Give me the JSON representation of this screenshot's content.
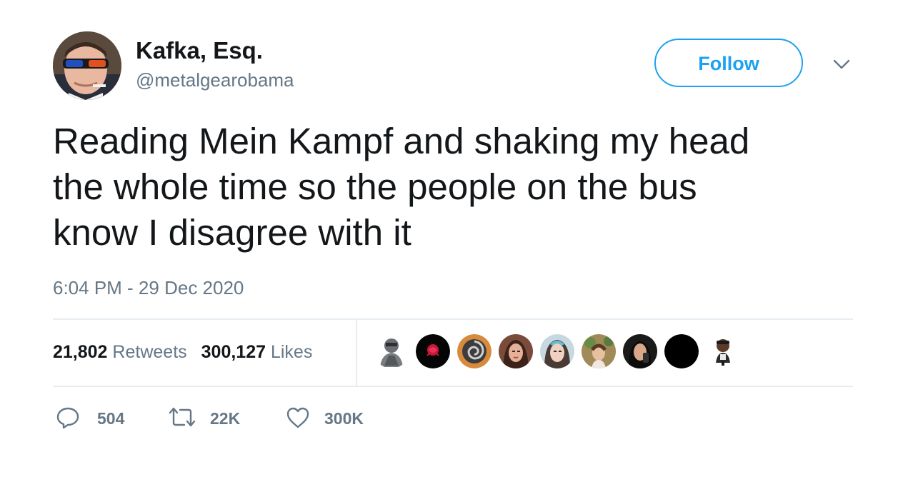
{
  "author": {
    "display_name": "Kafka, Esq.",
    "handle": "@metalgearobama",
    "avatar_icon": "profile-photo"
  },
  "follow_label": "Follow",
  "menu_icon": "chevron-down-icon",
  "tweet": {
    "lines": [
      "Reading Mein Kampf and shaking my head",
      "the whole time so the people on the bus",
      "know I disagree with it"
    ],
    "timestamp": "6:04 PM - 29 Dec 2020"
  },
  "stats": {
    "retweets_count": "21,802",
    "retweets_label": "Retweets",
    "likes_count": "300,127",
    "likes_label": "Likes"
  },
  "actions": {
    "reply_count": "504",
    "retweet_count": "22K",
    "like_count": "300K"
  },
  "colors": {
    "accent": "#1da1f2",
    "secondary_text": "#657786",
    "primary_text": "#14171a",
    "divider": "#e6ecf0"
  }
}
